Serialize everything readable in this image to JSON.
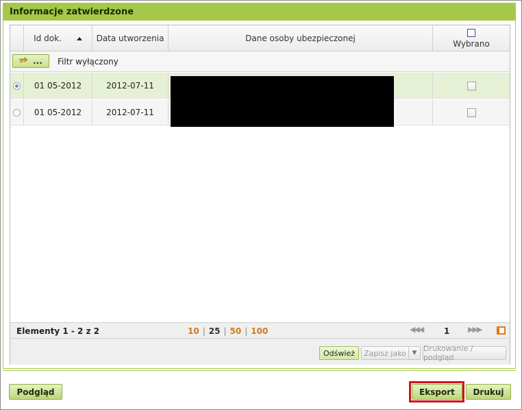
{
  "panel": {
    "title": "Informacje zatwierdzone"
  },
  "grid": {
    "columns": {
      "id": "Id dok.",
      "date": "Data utworzenia",
      "person": "Dane osoby ubezpieczonej",
      "selected": "Wybrano"
    },
    "filter": {
      "button_label": "...",
      "status": "Filtr wyłączony"
    },
    "rows": [
      {
        "id": "01 05-2012",
        "date": "2012-07-11",
        "selected_radio": true,
        "checked": false
      },
      {
        "id": "01 05-2012",
        "date": "2012-07-11",
        "selected_radio": false,
        "checked": false
      }
    ],
    "pager": {
      "items_label": "Elementy 1 - 2 z 2",
      "sizes": [
        "10",
        "25",
        "50",
        "100"
      ],
      "current_size": "25",
      "page": "1",
      "first_prev": "◀◀◀",
      "next_last": "▶▶▶"
    },
    "toolbar": {
      "refresh": "Odśwież",
      "save_as": "Zapisz jako",
      "print": "Drukowanie / podgląd"
    }
  },
  "buttons": {
    "preview": "Podgląd",
    "export": "Eksport",
    "print": "Drukuj"
  },
  "colors": {
    "accent": "#a5c84a",
    "selected_row": "#e6f0d4",
    "highlight": "#d0101a",
    "page_size_link": "#d07a1e"
  }
}
